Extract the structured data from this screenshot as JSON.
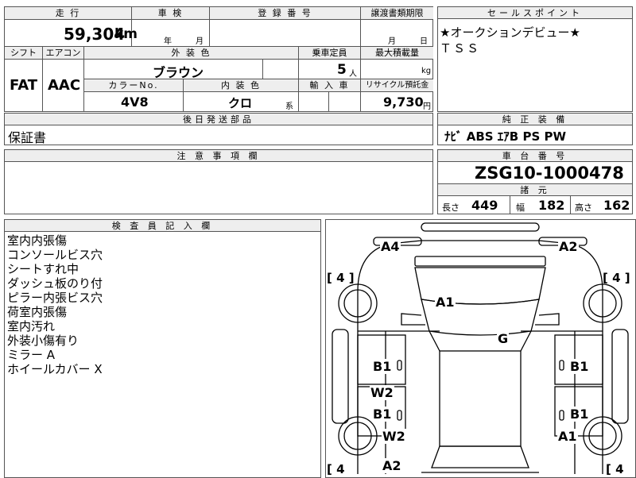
{
  "header_labels": {
    "mileage": "走 行",
    "inspection": "車 検",
    "registration": "登 録 番 号",
    "transfer_deadline": "譲渡書類期限",
    "sales_point": "セールスポイント",
    "shift": "シフト",
    "aircon": "エアコン",
    "exterior_color": "外 装 色",
    "capacity": "乗車定員",
    "max_load": "最大積載量",
    "color_no": "カラーNo.",
    "interior_color": "内 装 色",
    "import": "輸 入 車",
    "recycle": "リサイクル預託金",
    "later_parts": "後日発送部品",
    "genuine_equipment": "純 正 装 備",
    "notes": "注 意 事 項 欄",
    "chassis_no": "車 台 番 号",
    "specs": "諸 元",
    "inspector_notes": "検 査 員 記 入 欄"
  },
  "vehicle": {
    "mileage_value": "59,304",
    "mileage_unit": "km",
    "inspection_year": "年",
    "inspection_month": "月",
    "transfer_month": "月",
    "transfer_day": "日",
    "shift": "FAT",
    "aircon": "AAC",
    "exterior_color": "ブラウン",
    "capacity_value": "5",
    "capacity_unit": "人",
    "max_load_unit": "kg",
    "color_no": "4V8",
    "interior_color": "クロ",
    "interior_suffix": "系",
    "recycle_value": "9,730",
    "recycle_unit": "円",
    "later_parts": "保証書",
    "chassis_no": "ZSG10-1000478"
  },
  "sales_points": [
    "★オークションデビュー★",
    "ＴＳＳ"
  ],
  "genuine_equipment": "ﾅﾋﾞ ABS ｴｱB PS PW",
  "specs": {
    "length_label": "長さ",
    "length_value": "449",
    "width_label": "幅",
    "width_value": "182",
    "height_label": "高さ",
    "height_value": "162"
  },
  "inspector_notes": [
    "室内内張傷",
    "コンソールビス穴",
    "シートすれ中",
    "ダッシュ板のり付",
    "ピラー内張ビス穴",
    "荷室内張傷",
    "室内汚れ",
    "外装小傷有り",
    "ミラー A",
    "ホイールカバー X"
  ],
  "diagram": {
    "damage_marks": {
      "front_left": "A4",
      "front_right": "A2",
      "hood": "A1",
      "roof": "G",
      "left_door_front": "B1",
      "right_door_front": "B1",
      "left_rear_w": "W2",
      "left_door_rear": "B1",
      "right_door_rear": "B1",
      "left_rear_w2": "W2",
      "right_rear_a": "A1",
      "rear_center": "A2"
    },
    "tyre_labels": {
      "front_left": "[ 4 ]",
      "front_right": "[ 4 ]",
      "rear_left": "[ 4",
      "rear_right": "[ 4"
    }
  }
}
